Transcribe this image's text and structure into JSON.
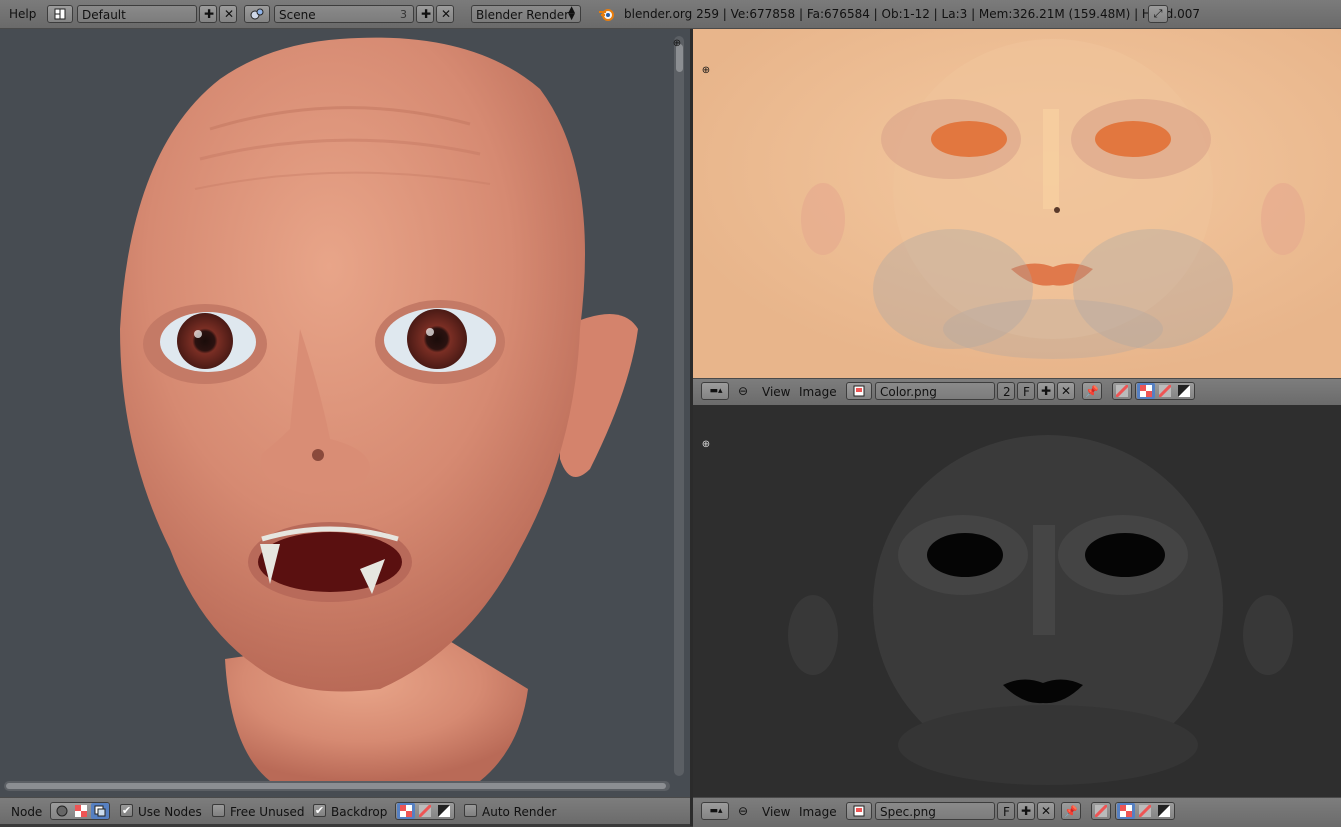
{
  "topbar": {
    "help": "Help",
    "screen_layout": "Default",
    "scene": "Scene",
    "scene_users": "3",
    "render_engine": "Blender Render",
    "status": "blender.org 259 | Ve:677858 | Fa:676584 | Ob:1-12 | La:3 | Mem:326.21M (159.48M) | Head.007"
  },
  "image_editor_top": {
    "view": "View",
    "image": "Image",
    "file": "Color.png",
    "users": "2",
    "fake_user": "F"
  },
  "image_editor_bottom": {
    "view": "View",
    "image": "Image",
    "file": "Spec.png",
    "fake_user": "F"
  },
  "node_editor": {
    "editor_label": "Node",
    "use_nodes": "Use Nodes",
    "free_unused": "Free Unused",
    "backdrop": "Backdrop",
    "auto_render": "Auto Render",
    "use_nodes_checked": true,
    "free_unused_checked": false,
    "backdrop_checked": true,
    "auto_render_checked": false
  },
  "colors": {
    "backdrop": "#474c52",
    "skin": "#d9917a",
    "texture_color": "#e8b88f",
    "texture_spec": "#2e2e2e"
  }
}
